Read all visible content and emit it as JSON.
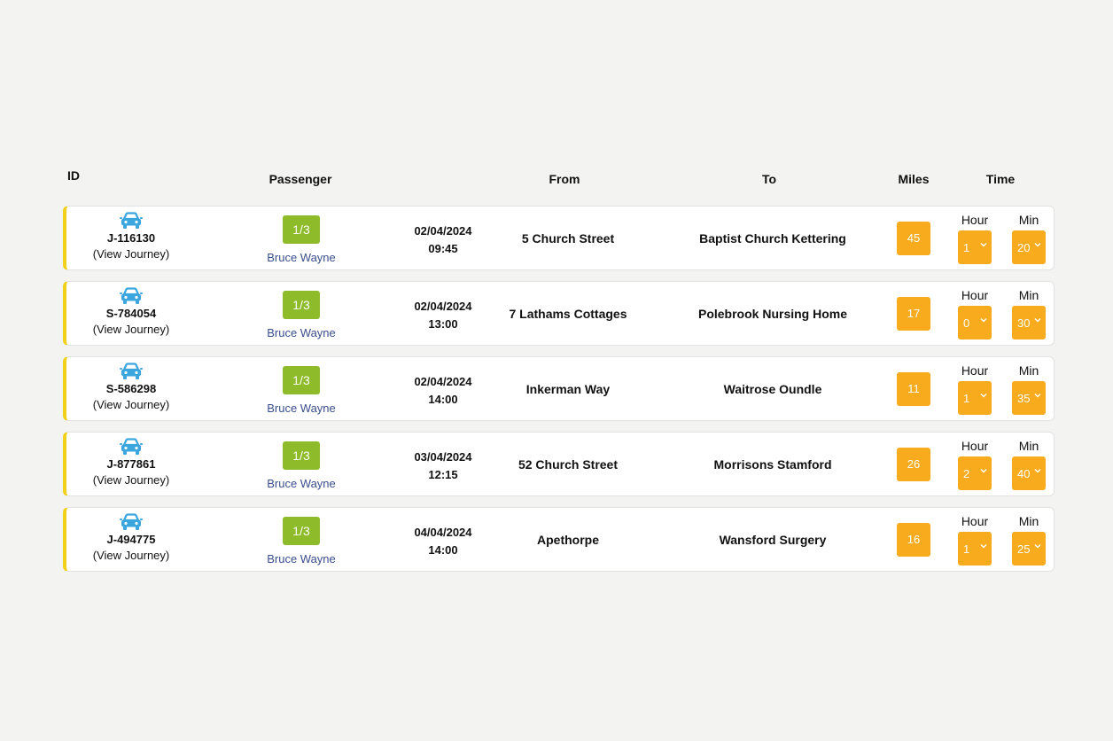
{
  "header": {
    "id": "ID",
    "passenger": "Passenger",
    "from": "From",
    "to": "To",
    "miles": "Miles",
    "time": "Time"
  },
  "labels": {
    "hour": "Hour",
    "min": "Min",
    "view": "(View Journey)"
  },
  "colors": {
    "accent_bar": "#f2d11b",
    "badge_green": "#8dbb29",
    "badge_orange": "#f7ab1d",
    "car_icon": "#3aa6dd",
    "passenger_link": "#3a4e8c"
  },
  "rows": [
    {
      "id": "J-116130",
      "pax": "1/3",
      "passenger": "Bruce Wayne",
      "date": "02/04/2024",
      "time": "09:45",
      "from": "5 Church Street",
      "to": "Baptist Church Kettering",
      "miles": "45",
      "hour": "1",
      "min": "20"
    },
    {
      "id": "S-784054",
      "pax": "1/3",
      "passenger": "Bruce Wayne",
      "date": "02/04/2024",
      "time": "13:00",
      "from": "7 Lathams Cottages",
      "to": "Polebrook Nursing Home",
      "miles": "17",
      "hour": "0",
      "min": "30"
    },
    {
      "id": "S-586298",
      "pax": "1/3",
      "passenger": "Bruce Wayne",
      "date": "02/04/2024",
      "time": "14:00",
      "from": "Inkerman Way",
      "to": "Waitrose Oundle",
      "miles": "11",
      "hour": "1",
      "min": "35"
    },
    {
      "id": "J-877861",
      "pax": "1/3",
      "passenger": "Bruce Wayne",
      "date": "03/04/2024",
      "time": "12:15",
      "from": "52 Church Street",
      "to": "Morrisons Stamford",
      "miles": "26",
      "hour": "2",
      "min": "40"
    },
    {
      "id": "J-494775",
      "pax": "1/3",
      "passenger": "Bruce Wayne",
      "date": "04/04/2024",
      "time": "14:00",
      "from": "Apethorpe",
      "to": "Wansford Surgery",
      "miles": "16",
      "hour": "1",
      "min": "25"
    }
  ]
}
